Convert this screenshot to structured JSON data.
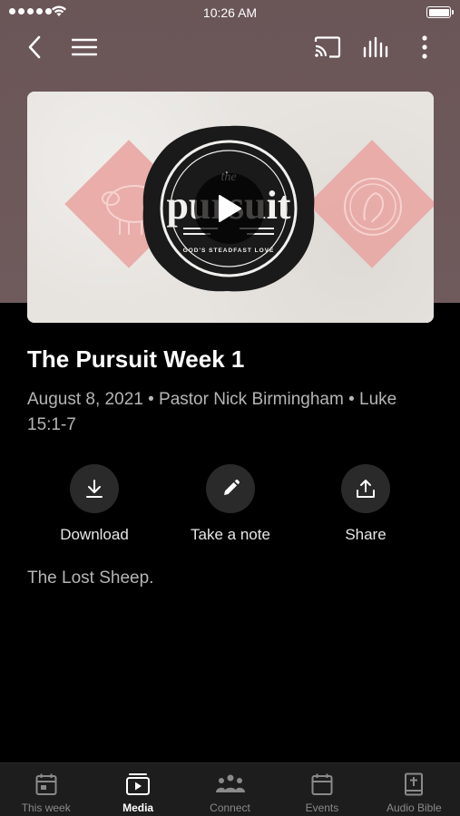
{
  "status_bar": {
    "time": "10:26 AM"
  },
  "sermon": {
    "title": "The Pursuit Week 1",
    "meta": "August 8, 2021 • Pastor Nick Birmingham  • Luke 15:1-7",
    "description": "The Lost Sheep.",
    "artwork": {
      "series_small": "the",
      "series": "pursuit",
      "tagline": "GOD'S STEADFAST LOVE"
    }
  },
  "actions": [
    {
      "label": "Download",
      "icon": "download-icon"
    },
    {
      "label": "Take a note",
      "icon": "pencil-icon"
    },
    {
      "label": "Share",
      "icon": "share-icon"
    }
  ],
  "tabs": [
    {
      "label": "This week",
      "icon": "calendar-day-icon",
      "active": false
    },
    {
      "label": "Media",
      "icon": "media-play-icon",
      "active": true
    },
    {
      "label": "Connect",
      "icon": "people-icon",
      "active": false
    },
    {
      "label": "Events",
      "icon": "calendar-icon",
      "active": false
    },
    {
      "label": "Audio Bible",
      "icon": "bible-icon",
      "active": false
    }
  ],
  "colors": {
    "header_bg": "#6f5a5c",
    "background": "#000000",
    "action_circle": "#2a2a2a",
    "tab_bar": "#1d1d1d",
    "diamond_pink": "#e9a6a3"
  }
}
